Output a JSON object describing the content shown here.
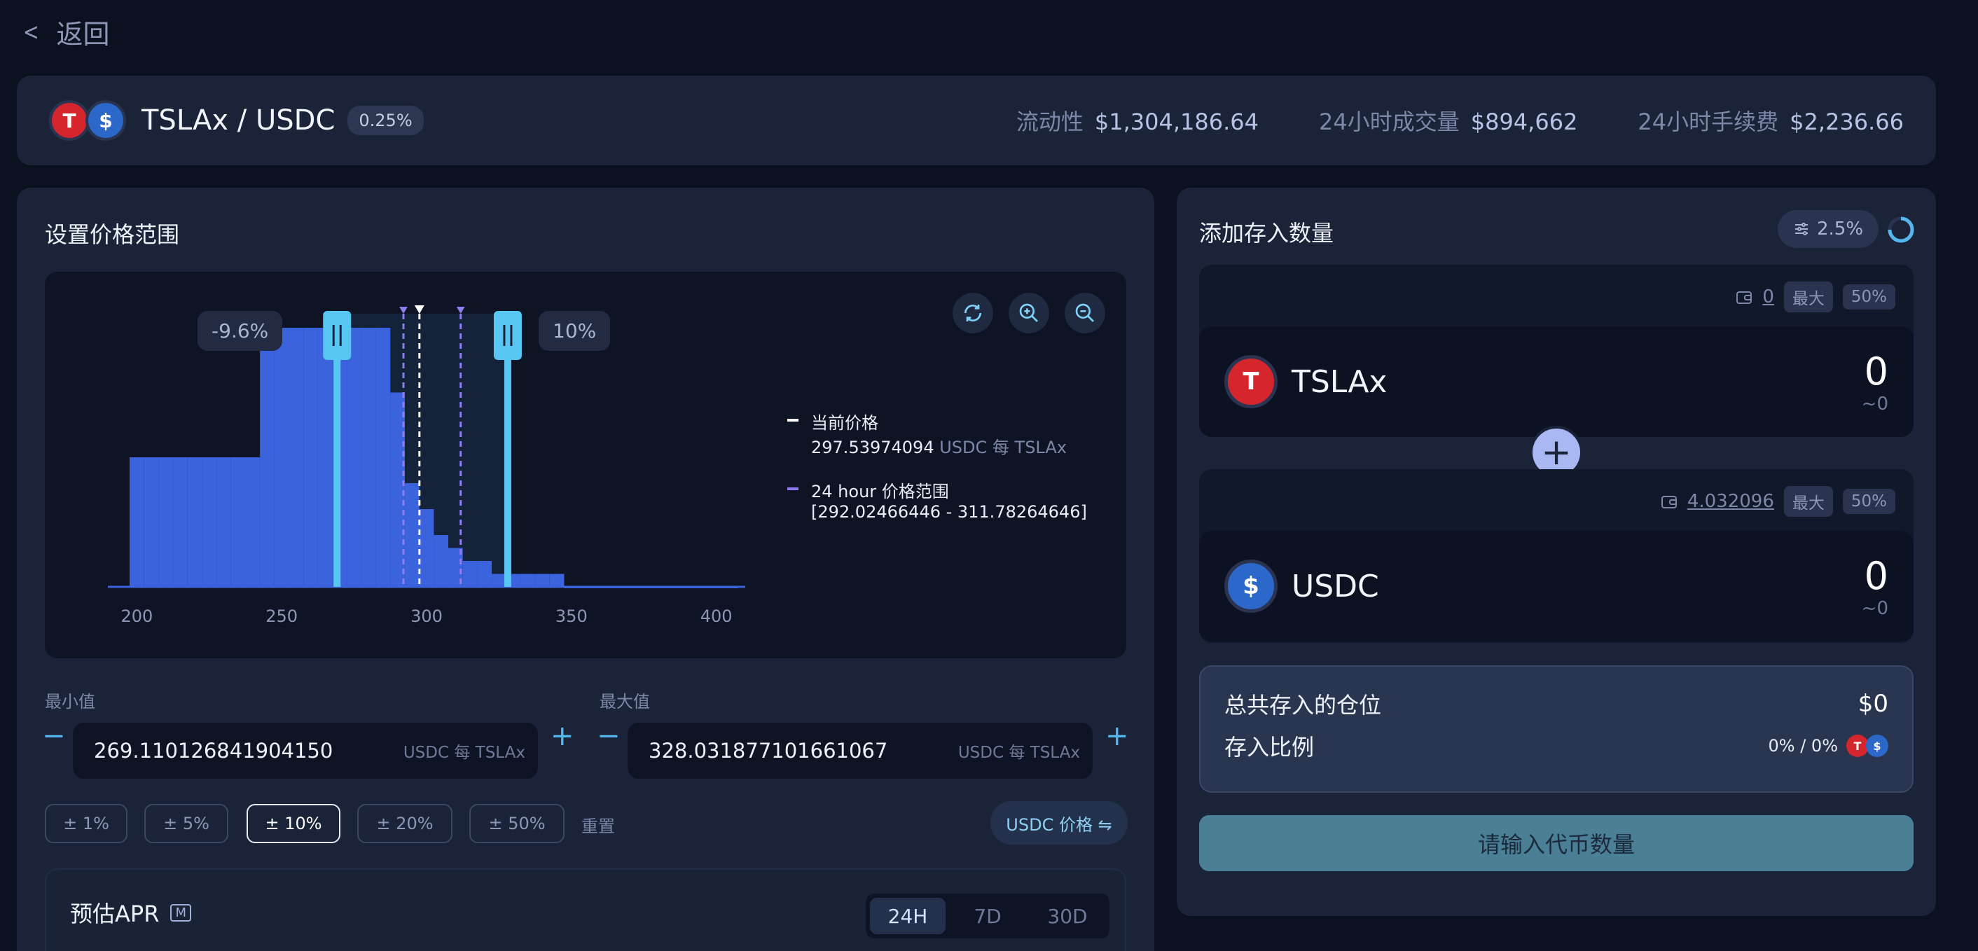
{
  "nav": {
    "back_label": "返回"
  },
  "pool": {
    "pair": "TSLAx / USDC",
    "fee": "0.25%",
    "stats": [
      {
        "label": "流动性",
        "value": "$1,304,186.64"
      },
      {
        "label": "24小时成交量",
        "value": "$894,662"
      },
      {
        "label": "24小时手续费",
        "value": "$2,236.66"
      }
    ]
  },
  "range_panel": {
    "title": "设置价格范围",
    "low_pct": "-9.6%",
    "high_pct": "10%",
    "legend": {
      "current_label": "当前价格",
      "current_value": "297.53974094",
      "current_unit": "USDC 每 TSLAx",
      "range_label": "24 hour 价格范围",
      "range_value": "[292.02466446 - 311.78264646]"
    },
    "min": {
      "label": "最小值",
      "value": "269.110126841904150",
      "unit": "USDC 每 TSLAx"
    },
    "max": {
      "label": "最大值",
      "value": "328.031877101661067",
      "unit": "USDC 每 TSLAx"
    },
    "presets": [
      "± 1%",
      "± 5%",
      "± 10%",
      "± 20%",
      "± 50%"
    ],
    "active_preset": "± 10%",
    "reset_label": "重置",
    "price_toggle": "USDC 价格 ⇋",
    "apr_title": "预估APR",
    "apr_badge": "M",
    "apr_tabs": [
      "24H",
      "7D",
      "30D"
    ],
    "apr_active": "24H"
  },
  "deposit_panel": {
    "title": "添加存入数量",
    "slippage": "2.5%",
    "tokens": [
      {
        "symbol": "TSLAx",
        "balance": "0",
        "max_label": "最大",
        "half_label": "50%",
        "amount": "0",
        "usd": "~0"
      },
      {
        "symbol": "USDC",
        "balance": "4.032096",
        "max_label": "最大",
        "half_label": "50%",
        "amount": "0",
        "usd": "~0"
      }
    ],
    "total_label": "总共存入的仓位",
    "total_value": "$0",
    "ratio_label": "存入比例",
    "ratio_value": "0% / 0%",
    "submit_label": "请输入代币数量"
  },
  "chart_data": {
    "type": "bar",
    "title": "",
    "xlabel": "",
    "ylabel": "",
    "xlim": [
      190,
      410
    ],
    "x_ticks": [
      "200",
      "250",
      "300",
      "350",
      "400"
    ],
    "colors": {
      "bars": "#3b63dd",
      "selected": "#57c6f2",
      "current": "#ffffff",
      "range24h": "#8e7cf0"
    },
    "current_price": 297.54,
    "range_24h": [
      292.02,
      311.78
    ],
    "selected_range": [
      269.11,
      328.03
    ],
    "x": [
      200,
      205,
      210,
      215,
      220,
      225,
      230,
      235,
      240,
      245,
      250,
      255,
      260,
      265,
      270,
      275,
      280,
      285,
      290,
      295,
      300,
      305,
      310,
      315,
      320,
      325,
      330,
      335,
      340,
      345,
      350,
      355,
      360,
      365,
      370,
      375,
      380,
      385,
      390,
      395,
      400,
      405
    ],
    "values": [
      1,
      1,
      1,
      1,
      1,
      1,
      1,
      1,
      1,
      2,
      2,
      2,
      2,
      2,
      2,
      2,
      2,
      2,
      1.5,
      0.8,
      0.6,
      0.4,
      0.3,
      0.2,
      0.2,
      0.1,
      0.1,
      0.1,
      0.1,
      0.1,
      0,
      0,
      0,
      0,
      0,
      0,
      0,
      0,
      0,
      0,
      0,
      0
    ]
  }
}
